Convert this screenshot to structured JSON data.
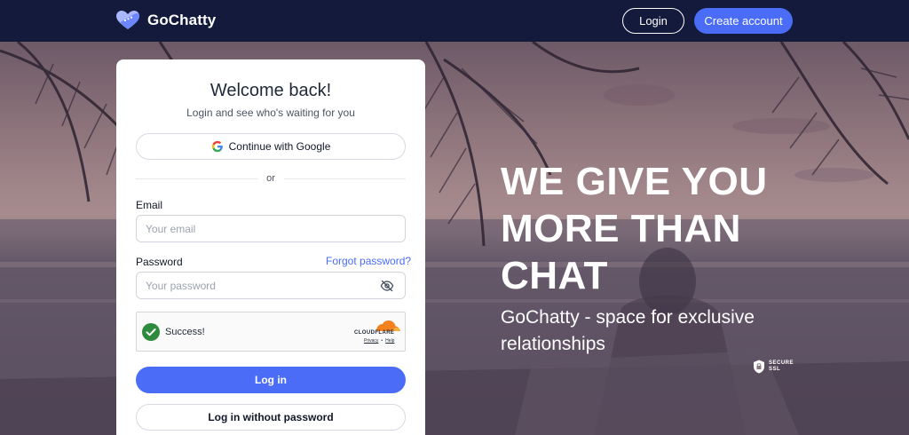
{
  "header": {
    "brand_name": "GoChatty",
    "login_label": "Login",
    "create_account_label": "Create account"
  },
  "hero": {
    "headline_lines": [
      "WE GIVE YOU",
      "MORE THAN",
      "CHAT"
    ],
    "subline": "GoChatty - space for exclusive relationships",
    "ssl_badge": {
      "line1": "SECURE",
      "line2": "SSL"
    }
  },
  "login_card": {
    "title": "Welcome back!",
    "subtitle": "Login and see who's waiting for you",
    "google_label": "Continue with Google",
    "divider_text": "or",
    "email_label": "Email",
    "email_placeholder": "Your email",
    "email_value": "",
    "password_label": "Password",
    "password_placeholder": "Your password",
    "password_value": "",
    "forgot_label": "Forgot password?",
    "captcha": {
      "status": "Success!",
      "provider": "CLOUDFLARE",
      "privacy_label": "Privacy",
      "separator": "•",
      "help_label": "Help"
    },
    "login_button": "Log in",
    "no_password_button": "Log in without password"
  },
  "colors": {
    "topbar": "#131a3b",
    "accent": "#4a6cf7",
    "card": "#ffffff",
    "success": "#2e8b3e",
    "cloudflare": "#f48120"
  },
  "icons": {
    "brand": "heart-logo-icon",
    "google": "google-g-icon",
    "password_toggle": "eye-off-icon",
    "captcha_success": "check-circle-icon",
    "ssl": "shield-lock-icon"
  }
}
